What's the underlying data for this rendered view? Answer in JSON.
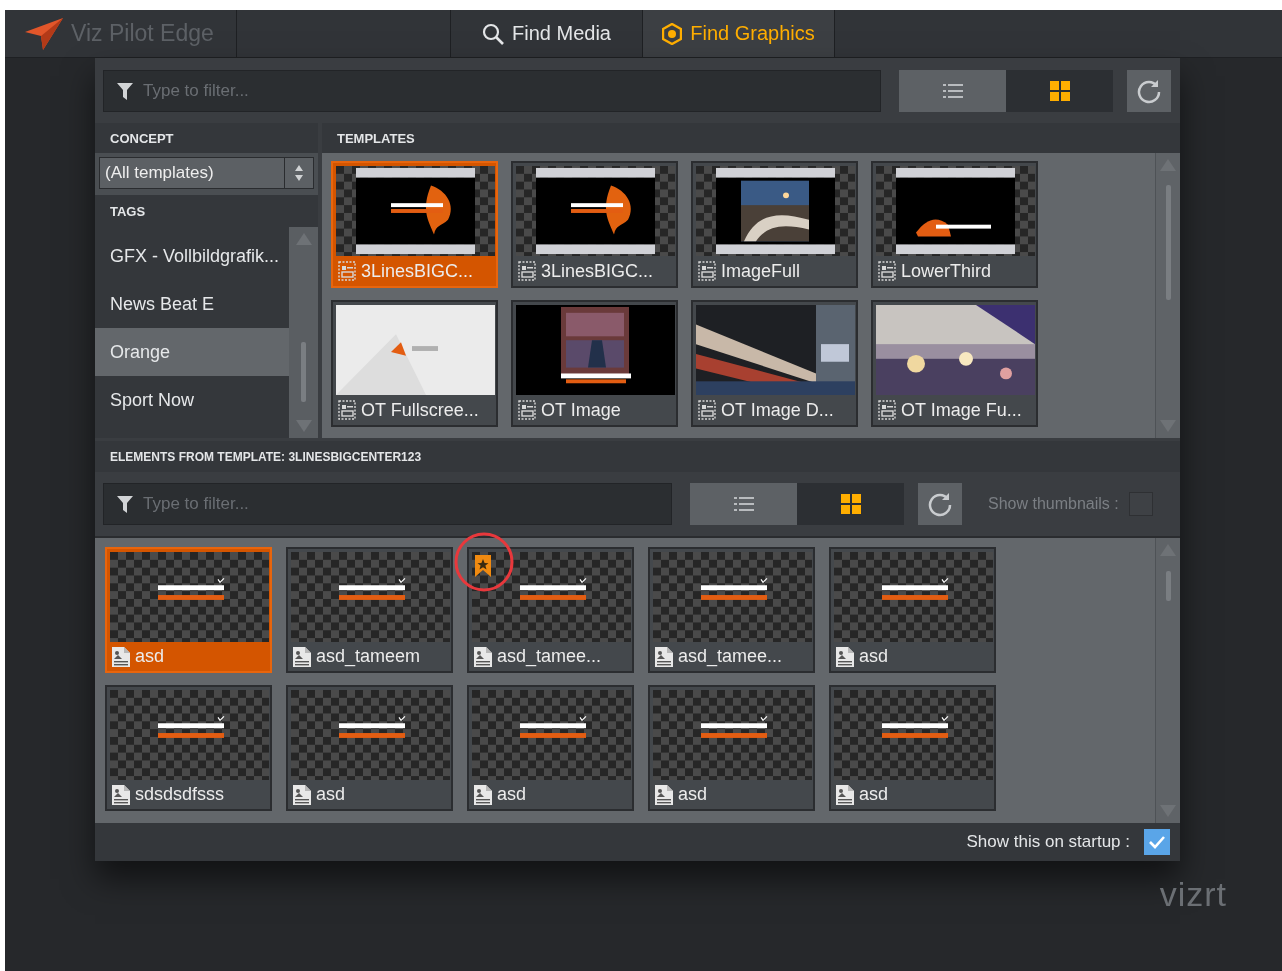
{
  "app": {
    "title": "Viz Pilot Edge"
  },
  "tabs": [
    {
      "label": "Find Media",
      "selected": false
    },
    {
      "label": "Find Graphics",
      "selected": true
    }
  ],
  "filter": {
    "placeholder": "Type to filter..."
  },
  "view_toggle": [
    {
      "selected": false
    },
    {
      "selected": true
    }
  ],
  "concept": {
    "heading": "CONCEPT",
    "value": "(All templates)"
  },
  "tags": {
    "heading": "TAGS",
    "items": [
      {
        "label": "GFX - Vollbildgrafik...",
        "selected": false
      },
      {
        "label": "News Beat E",
        "selected": false
      },
      {
        "label": "Orange",
        "selected": true
      },
      {
        "label": "Sport Now",
        "selected": false
      }
    ]
  },
  "templates": {
    "heading": "TEMPLATES",
    "items": [
      {
        "name": "3LinesBIGC...",
        "selected": true
      },
      {
        "name": "3LinesBIGC...",
        "selected": false
      },
      {
        "name": "ImageFull",
        "selected": false
      },
      {
        "name": "LowerThird",
        "selected": false
      },
      {
        "name": "OT Fullscree...",
        "selected": false
      },
      {
        "name": "OT Image",
        "selected": false
      },
      {
        "name": "OT Image D...",
        "selected": false
      },
      {
        "name": "OT Image Fu...",
        "selected": false
      }
    ]
  },
  "elements": {
    "heading": "ELEMENTS FROM TEMPLATE: 3LINESBIGCENTER123",
    "filter": {
      "placeholder": "Type to filter..."
    },
    "view_toggle": [
      {
        "selected": false
      },
      {
        "selected": true
      }
    ],
    "show_thumbnails": {
      "label": "Show thumbnails :",
      "checked": false
    },
    "items": [
      {
        "name": "asd",
        "selected": true,
        "bookmarked": false,
        "circled": false
      },
      {
        "name": "asd_tameem",
        "selected": false,
        "bookmarked": false,
        "circled": false
      },
      {
        "name": "asd_tamee...",
        "selected": false,
        "bookmarked": true,
        "circled": true
      },
      {
        "name": "asd_tamee...",
        "selected": false,
        "bookmarked": false,
        "circled": false
      },
      {
        "name": "asd",
        "selected": false,
        "bookmarked": false,
        "circled": false
      },
      {
        "name": "sdsdsdfsss",
        "selected": false,
        "bookmarked": false,
        "circled": false
      },
      {
        "name": "asd",
        "selected": false,
        "bookmarked": false,
        "circled": false
      },
      {
        "name": "asd",
        "selected": false,
        "bookmarked": false,
        "circled": false
      },
      {
        "name": "asd",
        "selected": false,
        "bookmarked": false,
        "circled": false
      },
      {
        "name": "asd",
        "selected": false,
        "bookmarked": false,
        "circled": false
      }
    ]
  },
  "footer": {
    "label": "Show this on startup :",
    "checked": true
  },
  "brand": "vizrt"
}
